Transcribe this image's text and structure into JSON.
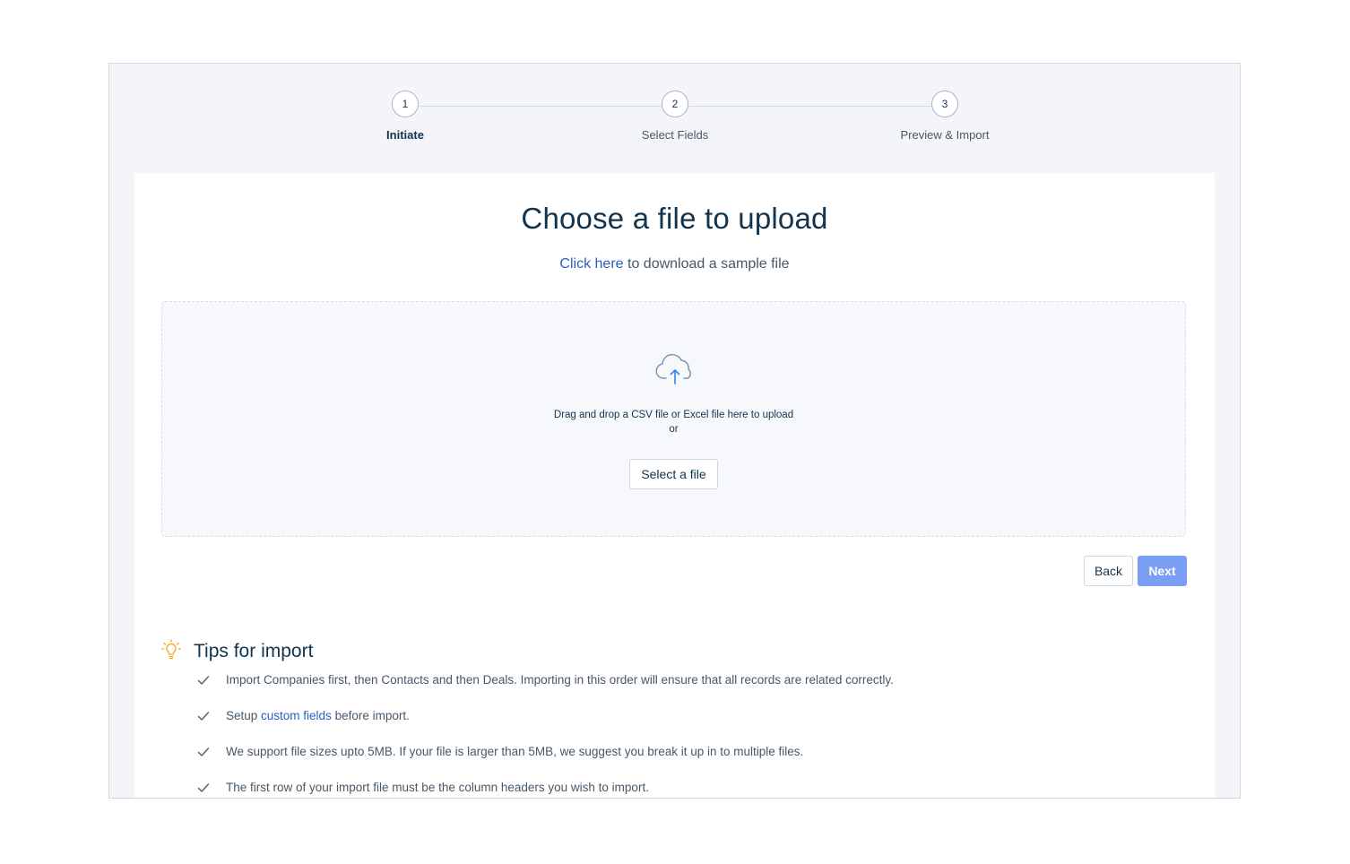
{
  "stepper": {
    "steps": [
      {
        "number": "1",
        "label": "Initiate"
      },
      {
        "number": "2",
        "label": "Select Fields"
      },
      {
        "number": "3",
        "label": "Preview & Import"
      }
    ],
    "active_step": 1
  },
  "upload": {
    "title": "Choose a file to upload",
    "sample_link": "Click here",
    "sample_text": " to download a sample file",
    "dropzone_text": "Drag and drop a CSV file or Excel file here to upload",
    "dropzone_or": "or",
    "select_button": "Select a file"
  },
  "actions": {
    "back_label": "Back",
    "next_label": "Next"
  },
  "tips": {
    "title": "Tips for import",
    "items": [
      {
        "text": "Import Companies first, then Contacts and then Deals. Importing in this order will ensure that all records are related correctly."
      },
      {
        "pre": "Setup ",
        "link": "custom fields",
        "post": " before import."
      },
      {
        "text": "We support file sizes upto 5MB. If your file is larger than 5MB, we suggest you break it up in to multiple files."
      },
      {
        "text": "The first row of your import file must be the column headers you wish to import."
      }
    ]
  },
  "colors": {
    "primary": "#2c5cc5",
    "next_button": "#7b9ef5",
    "text_dark": "#12344d",
    "bulb": "#f5a623"
  },
  "icons": {
    "upload": "cloud-upload-icon",
    "tips": "lightbulb-icon",
    "tip_item": "checkmark-icon"
  }
}
